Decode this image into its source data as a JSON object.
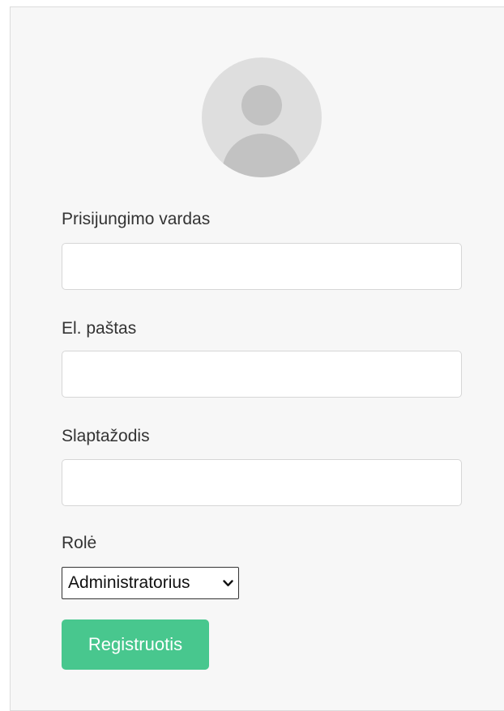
{
  "form": {
    "username_label": "Prisijungimo vardas",
    "username_value": "",
    "email_label": "El. paštas",
    "email_value": "",
    "password_label": "Slaptažodis",
    "password_value": "",
    "role_label": "Rolė",
    "role_selected": "Administratorius",
    "submit_label": "Registruotis"
  },
  "icons": {
    "avatar": "user-avatar-icon",
    "select_arrow": "chevron-down-icon"
  },
  "colors": {
    "primary_button": "#48c78e",
    "card_background": "#f7f7f7",
    "avatar_background": "#dedede",
    "avatar_figure": "#c2c2c2"
  }
}
